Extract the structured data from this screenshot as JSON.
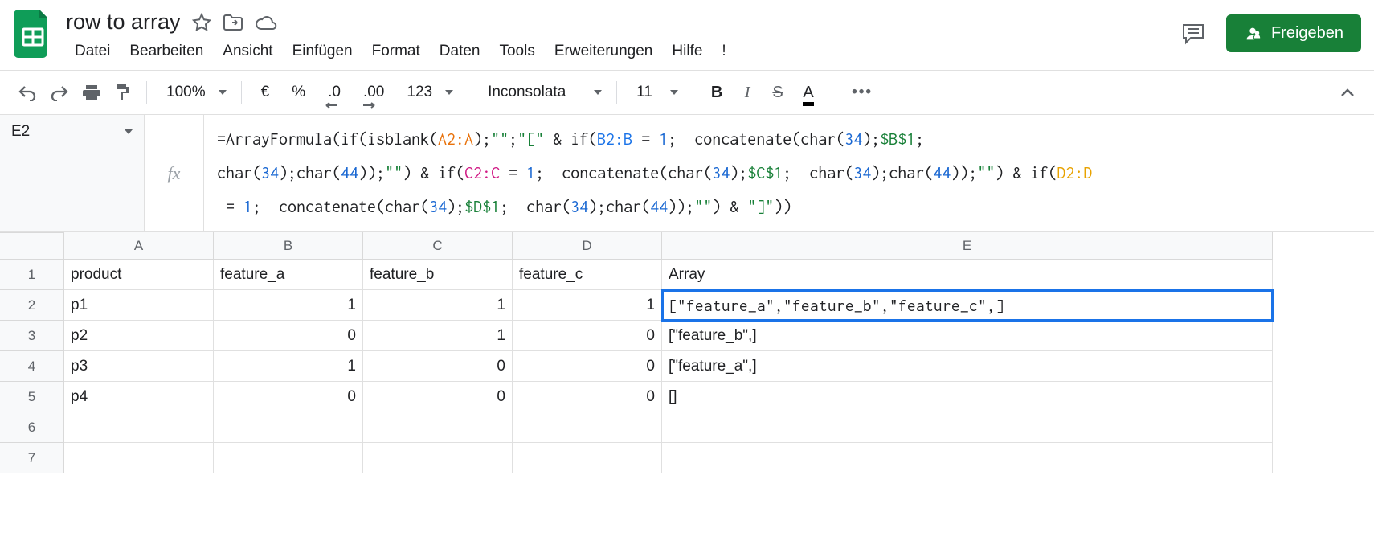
{
  "doc": {
    "title": "row to array"
  },
  "menus": [
    "Datei",
    "Bearbeiten",
    "Ansicht",
    "Einfügen",
    "Format",
    "Daten",
    "Tools",
    "Erweiterungen",
    "Hilfe",
    "!"
  ],
  "share_label": "Freigeben",
  "toolbar": {
    "zoom": "100%",
    "currency_symbol": "€",
    "percent": "%",
    "dec_decrease": ".0",
    "dec_increase": ".00",
    "format_123": "123",
    "font_name": "Inconsolata",
    "font_size": "11",
    "more": "•••"
  },
  "namebox": "E2",
  "fx_label": "fx",
  "formula_tokens": [
    {
      "t": "p",
      "v": "=ArrayFormula("
    },
    {
      "t": "p",
      "v": "if"
    },
    {
      "t": "p",
      "v": "(isblank("
    },
    {
      "t": "a",
      "v": "A2:A"
    },
    {
      "t": "p",
      "v": ");"
    },
    {
      "t": "s",
      "v": "\"\""
    },
    {
      "t": "p",
      "v": ";"
    },
    {
      "t": "s",
      "v": "\"[\""
    },
    {
      "t": "p",
      "v": " & "
    },
    {
      "t": "p",
      "v": "if"
    },
    {
      "t": "p",
      "v": "("
    },
    {
      "t": "b",
      "v": "B2:B"
    },
    {
      "t": "p",
      "v": " = "
    },
    {
      "t": "n",
      "v": "1"
    },
    {
      "t": "p",
      "v": ";  concatenate(char("
    },
    {
      "t": "n",
      "v": "34"
    },
    {
      "t": "p",
      "v": ");"
    },
    {
      "t": "g",
      "v": "$B$1"
    },
    {
      "t": "p",
      "v": "; "
    },
    {
      "t": "br",
      "v": ""
    },
    {
      "t": "p",
      "v": "char("
    },
    {
      "t": "n",
      "v": "34"
    },
    {
      "t": "p",
      "v": ");char("
    },
    {
      "t": "n",
      "v": "44"
    },
    {
      "t": "p",
      "v": "));"
    },
    {
      "t": "s",
      "v": "\"\""
    },
    {
      "t": "p",
      "v": ") & "
    },
    {
      "t": "p",
      "v": "if"
    },
    {
      "t": "p",
      "v": "("
    },
    {
      "t": "c",
      "v": "C2:C"
    },
    {
      "t": "p",
      "v": " = "
    },
    {
      "t": "n",
      "v": "1"
    },
    {
      "t": "p",
      "v": ";  concatenate(char("
    },
    {
      "t": "n",
      "v": "34"
    },
    {
      "t": "p",
      "v": ");"
    },
    {
      "t": "g",
      "v": "$C$1"
    },
    {
      "t": "p",
      "v": ";  char("
    },
    {
      "t": "n",
      "v": "34"
    },
    {
      "t": "p",
      "v": ");char("
    },
    {
      "t": "n",
      "v": "44"
    },
    {
      "t": "p",
      "v": "));"
    },
    {
      "t": "s",
      "v": "\"\""
    },
    {
      "t": "p",
      "v": ") & "
    },
    {
      "t": "p",
      "v": "if"
    },
    {
      "t": "p",
      "v": "("
    },
    {
      "t": "d",
      "v": "D2:D"
    },
    {
      "t": "br",
      "v": ""
    },
    {
      "t": "p",
      "v": " = "
    },
    {
      "t": "n",
      "v": "1"
    },
    {
      "t": "p",
      "v": ";  concatenate(char("
    },
    {
      "t": "n",
      "v": "34"
    },
    {
      "t": "p",
      "v": ");"
    },
    {
      "t": "g",
      "v": "$D$1"
    },
    {
      "t": "p",
      "v": ";  char("
    },
    {
      "t": "n",
      "v": "34"
    },
    {
      "t": "p",
      "v": ");char("
    },
    {
      "t": "n",
      "v": "44"
    },
    {
      "t": "p",
      "v": "));"
    },
    {
      "t": "s",
      "v": "\"\""
    },
    {
      "t": "p",
      "v": ") & "
    },
    {
      "t": "s",
      "v": "\"]\""
    },
    {
      "t": "p",
      "v": "))"
    }
  ],
  "columns": [
    "A",
    "B",
    "C",
    "D",
    "E"
  ],
  "rows": [
    {
      "n": "1",
      "A": "product",
      "B": "feature_a",
      "C": "feature_b",
      "D": "feature_c",
      "E": "Array"
    },
    {
      "n": "2",
      "A": "p1",
      "B": "1",
      "C": "1",
      "D": "1",
      "E": "[\"feature_a\",\"feature_b\",\"feature_c\",]"
    },
    {
      "n": "3",
      "A": "p2",
      "B": "0",
      "C": "1",
      "D": "0",
      "E": "[\"feature_b\",]"
    },
    {
      "n": "4",
      "A": "p3",
      "B": "1",
      "C": "0",
      "D": "0",
      "E": "[\"feature_a\",]"
    },
    {
      "n": "5",
      "A": "p4",
      "B": "0",
      "C": "0",
      "D": "0",
      "E": "[]"
    },
    {
      "n": "6",
      "A": "",
      "B": "",
      "C": "",
      "D": "",
      "E": ""
    },
    {
      "n": "7",
      "A": "",
      "B": "",
      "C": "",
      "D": "",
      "E": ""
    }
  ],
  "selected_cell": "E2"
}
